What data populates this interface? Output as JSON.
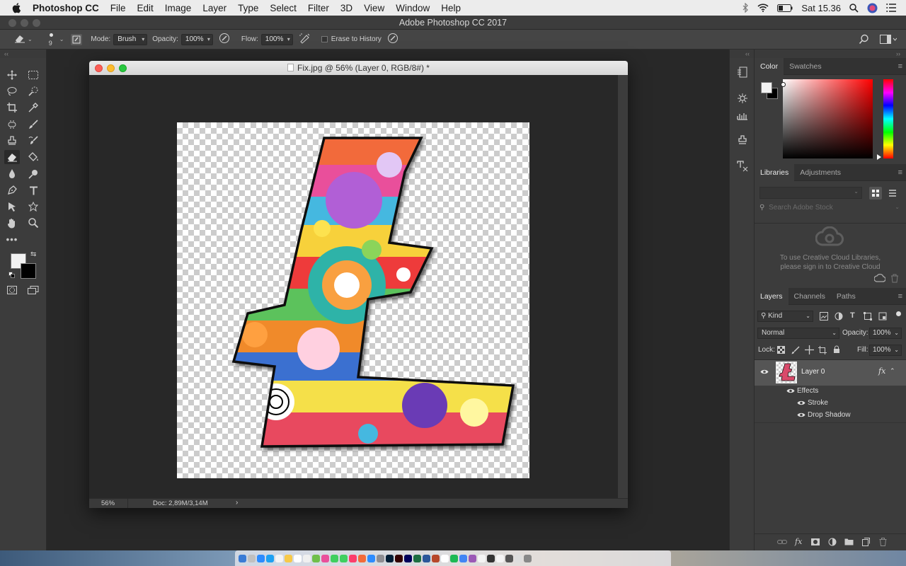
{
  "menubar": {
    "app_name": "Photoshop CC",
    "items": [
      "File",
      "Edit",
      "Image",
      "Layer",
      "Type",
      "Select",
      "Filter",
      "3D",
      "View",
      "Window",
      "Help"
    ],
    "clock": "Sat 15.36"
  },
  "window": {
    "title": "Adobe Photoshop CC 2017"
  },
  "options": {
    "brush_size": "9",
    "mode_label": "Mode:",
    "mode_value": "Brush",
    "opacity_label": "Opacity:",
    "opacity_value": "100%",
    "flow_label": "Flow:",
    "flow_value": "100%",
    "erase_to_history_label": "Erase to History"
  },
  "document": {
    "title": "Fix.jpg @ 56% (Layer 0, RGB/8#) *",
    "zoom": "56%",
    "doc_info": "Doc: 2,89M/3,14M"
  },
  "color_panel": {
    "tabs": [
      "Color",
      "Swatches"
    ],
    "accent": "#ff0000"
  },
  "libraries_panel": {
    "tabs": [
      "Libraries",
      "Adjustments"
    ],
    "search_placeholder": "Search Adobe Stock",
    "message_line1": "To use Creative Cloud Libraries,",
    "message_line2": "please sign in to Creative Cloud"
  },
  "layers_panel": {
    "tabs": [
      "Layers",
      "Channels",
      "Paths"
    ],
    "filter_kind": "Kind",
    "blend_mode": "Normal",
    "opacity_label": "Opacity:",
    "opacity_value": "100%",
    "lock_label": "Lock:",
    "fill_label": "Fill:",
    "fill_value": "100%",
    "layer_name": "Layer 0",
    "effects_label": "Effects",
    "effects": [
      "Stroke",
      "Drop Shadow"
    ]
  }
}
